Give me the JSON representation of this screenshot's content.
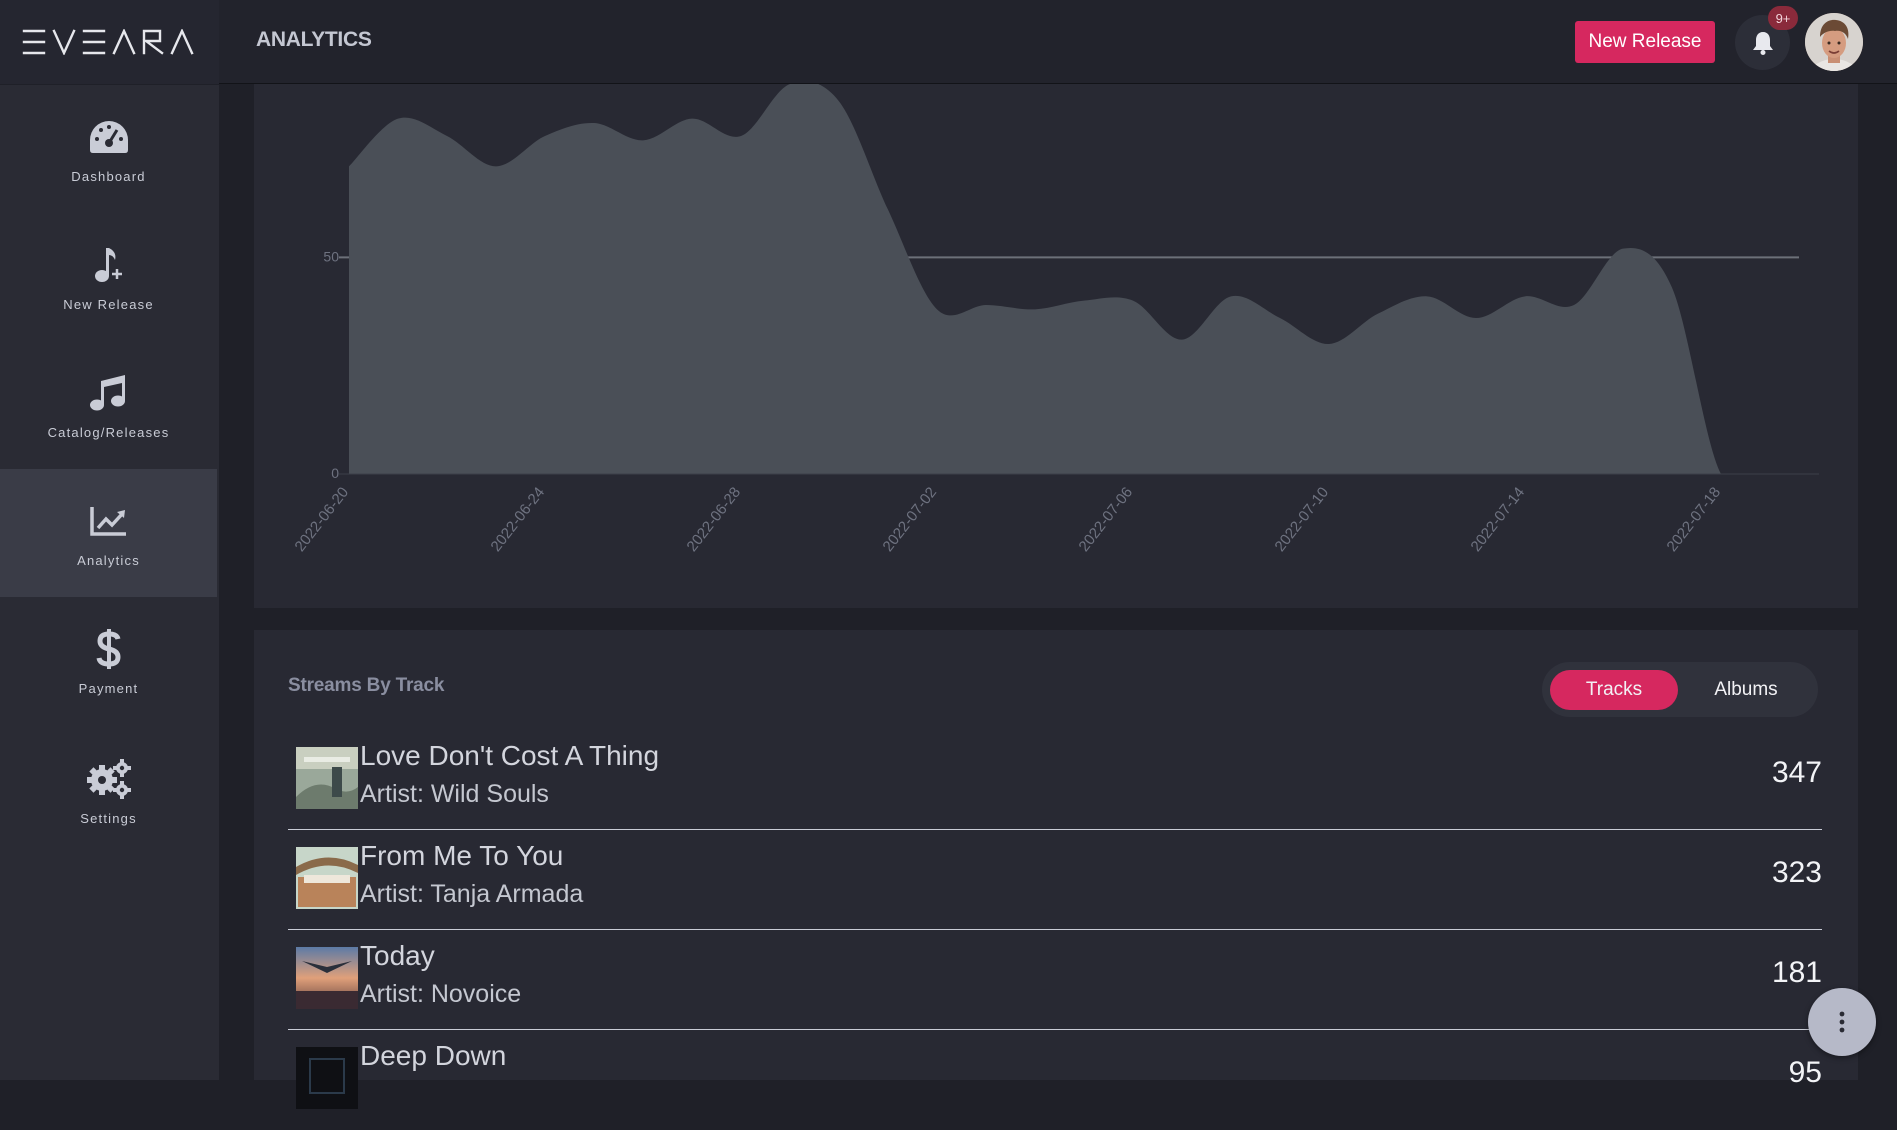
{
  "app": {
    "logo_text": "EVEARA"
  },
  "header": {
    "title": "ANALYTICS",
    "new_release_label": "New Release",
    "notification_badge": "9+"
  },
  "sidebar": {
    "items": [
      {
        "label": "Dashboard",
        "icon": "gauge-icon"
      },
      {
        "label": "New Release",
        "icon": "music-note-plus-icon"
      },
      {
        "label": "Catalog/Releases",
        "icon": "music-notes-icon"
      },
      {
        "label": "Analytics",
        "icon": "line-chart-icon",
        "active": true
      },
      {
        "label": "Payment",
        "icon": "dollar-icon"
      },
      {
        "label": "Settings",
        "icon": "gears-icon"
      }
    ]
  },
  "chart_data": {
    "type": "area",
    "ytick_labels": [
      "50",
      "0"
    ],
    "x_tick_labels": [
      "2022-06-20",
      "2022-06-24",
      "2022-06-28",
      "2022-07-02",
      "2022-07-06",
      "2022-07-10",
      "2022-07-14",
      "2022-07-18"
    ],
    "x": [
      "2022-06-20",
      "2022-06-21",
      "2022-06-22",
      "2022-06-23",
      "2022-06-24",
      "2022-06-25",
      "2022-06-26",
      "2022-06-27",
      "2022-06-28",
      "2022-06-29",
      "2022-06-30",
      "2022-07-01",
      "2022-07-02",
      "2022-07-03",
      "2022-07-04",
      "2022-07-05",
      "2022-07-06",
      "2022-07-07",
      "2022-07-08",
      "2022-07-09",
      "2022-07-10",
      "2022-07-11",
      "2022-07-12",
      "2022-07-13",
      "2022-07-14",
      "2022-07-15",
      "2022-07-16",
      "2022-07-17",
      "2022-07-18",
      "2022-07-19",
      "2022-07-20"
    ],
    "values": [
      71,
      82,
      78,
      71,
      78,
      81,
      77,
      82,
      78,
      90,
      86,
      61,
      38,
      39,
      38,
      40,
      40,
      31,
      41,
      36,
      30,
      37,
      41,
      36,
      41,
      39,
      52,
      43,
      0,
      0,
      0
    ],
    "reference_line": 50,
    "ylim": [
      0,
      90
    ],
    "colors": {
      "area": "#4a4f57",
      "reference": "#6c7079",
      "tick_text": "#6e7280"
    }
  },
  "streams": {
    "title": "Streams By Track",
    "toggle": {
      "tracks_label": "Tracks",
      "albums_label": "Albums",
      "selected": "Tracks"
    },
    "rows": [
      {
        "title": "Love Don't Cost A Thing",
        "artist": "Artist: Wild Souls",
        "count": "347"
      },
      {
        "title": "From Me To You",
        "artist": "Artist: Tanja Armada",
        "count": "323"
      },
      {
        "title": "Today",
        "artist": "Artist: Novoice",
        "count": "181"
      },
      {
        "title": "Deep Down",
        "artist": "",
        "count": "95"
      }
    ]
  },
  "colors": {
    "accent": "#d6285f",
    "background": "#1f2028",
    "panel": "#282933"
  }
}
